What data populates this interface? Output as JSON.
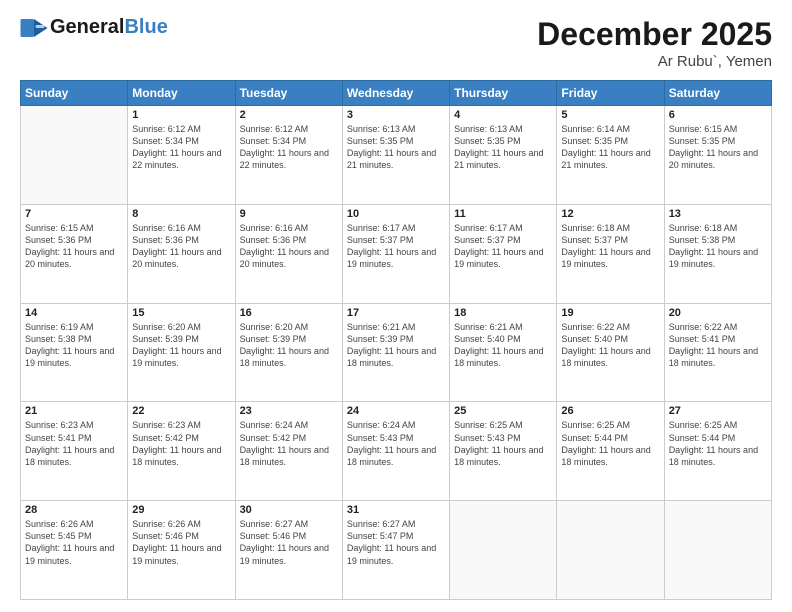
{
  "header": {
    "logo_general": "General",
    "logo_blue": "Blue",
    "month": "December 2025",
    "location": "Ar Rubu`, Yemen"
  },
  "days_of_week": [
    "Sunday",
    "Monday",
    "Tuesday",
    "Wednesday",
    "Thursday",
    "Friday",
    "Saturday"
  ],
  "weeks": [
    [
      {
        "day": "",
        "info": ""
      },
      {
        "day": "1",
        "info": "Sunrise: 6:12 AM\nSunset: 5:34 PM\nDaylight: 11 hours and 22 minutes."
      },
      {
        "day": "2",
        "info": "Sunrise: 6:12 AM\nSunset: 5:34 PM\nDaylight: 11 hours and 22 minutes."
      },
      {
        "day": "3",
        "info": "Sunrise: 6:13 AM\nSunset: 5:35 PM\nDaylight: 11 hours and 21 minutes."
      },
      {
        "day": "4",
        "info": "Sunrise: 6:13 AM\nSunset: 5:35 PM\nDaylight: 11 hours and 21 minutes."
      },
      {
        "day": "5",
        "info": "Sunrise: 6:14 AM\nSunset: 5:35 PM\nDaylight: 11 hours and 21 minutes."
      },
      {
        "day": "6",
        "info": "Sunrise: 6:15 AM\nSunset: 5:35 PM\nDaylight: 11 hours and 20 minutes."
      }
    ],
    [
      {
        "day": "7",
        "info": "Sunrise: 6:15 AM\nSunset: 5:36 PM\nDaylight: 11 hours and 20 minutes."
      },
      {
        "day": "8",
        "info": "Sunrise: 6:16 AM\nSunset: 5:36 PM\nDaylight: 11 hours and 20 minutes."
      },
      {
        "day": "9",
        "info": "Sunrise: 6:16 AM\nSunset: 5:36 PM\nDaylight: 11 hours and 20 minutes."
      },
      {
        "day": "10",
        "info": "Sunrise: 6:17 AM\nSunset: 5:37 PM\nDaylight: 11 hours and 19 minutes."
      },
      {
        "day": "11",
        "info": "Sunrise: 6:17 AM\nSunset: 5:37 PM\nDaylight: 11 hours and 19 minutes."
      },
      {
        "day": "12",
        "info": "Sunrise: 6:18 AM\nSunset: 5:37 PM\nDaylight: 11 hours and 19 minutes."
      },
      {
        "day": "13",
        "info": "Sunrise: 6:18 AM\nSunset: 5:38 PM\nDaylight: 11 hours and 19 minutes."
      }
    ],
    [
      {
        "day": "14",
        "info": "Sunrise: 6:19 AM\nSunset: 5:38 PM\nDaylight: 11 hours and 19 minutes."
      },
      {
        "day": "15",
        "info": "Sunrise: 6:20 AM\nSunset: 5:39 PM\nDaylight: 11 hours and 19 minutes."
      },
      {
        "day": "16",
        "info": "Sunrise: 6:20 AM\nSunset: 5:39 PM\nDaylight: 11 hours and 18 minutes."
      },
      {
        "day": "17",
        "info": "Sunrise: 6:21 AM\nSunset: 5:39 PM\nDaylight: 11 hours and 18 minutes."
      },
      {
        "day": "18",
        "info": "Sunrise: 6:21 AM\nSunset: 5:40 PM\nDaylight: 11 hours and 18 minutes."
      },
      {
        "day": "19",
        "info": "Sunrise: 6:22 AM\nSunset: 5:40 PM\nDaylight: 11 hours and 18 minutes."
      },
      {
        "day": "20",
        "info": "Sunrise: 6:22 AM\nSunset: 5:41 PM\nDaylight: 11 hours and 18 minutes."
      }
    ],
    [
      {
        "day": "21",
        "info": "Sunrise: 6:23 AM\nSunset: 5:41 PM\nDaylight: 11 hours and 18 minutes."
      },
      {
        "day": "22",
        "info": "Sunrise: 6:23 AM\nSunset: 5:42 PM\nDaylight: 11 hours and 18 minutes."
      },
      {
        "day": "23",
        "info": "Sunrise: 6:24 AM\nSunset: 5:42 PM\nDaylight: 11 hours and 18 minutes."
      },
      {
        "day": "24",
        "info": "Sunrise: 6:24 AM\nSunset: 5:43 PM\nDaylight: 11 hours and 18 minutes."
      },
      {
        "day": "25",
        "info": "Sunrise: 6:25 AM\nSunset: 5:43 PM\nDaylight: 11 hours and 18 minutes."
      },
      {
        "day": "26",
        "info": "Sunrise: 6:25 AM\nSunset: 5:44 PM\nDaylight: 11 hours and 18 minutes."
      },
      {
        "day": "27",
        "info": "Sunrise: 6:25 AM\nSunset: 5:44 PM\nDaylight: 11 hours and 18 minutes."
      }
    ],
    [
      {
        "day": "28",
        "info": "Sunrise: 6:26 AM\nSunset: 5:45 PM\nDaylight: 11 hours and 19 minutes."
      },
      {
        "day": "29",
        "info": "Sunrise: 6:26 AM\nSunset: 5:46 PM\nDaylight: 11 hours and 19 minutes."
      },
      {
        "day": "30",
        "info": "Sunrise: 6:27 AM\nSunset: 5:46 PM\nDaylight: 11 hours and 19 minutes."
      },
      {
        "day": "31",
        "info": "Sunrise: 6:27 AM\nSunset: 5:47 PM\nDaylight: 11 hours and 19 minutes."
      },
      {
        "day": "",
        "info": ""
      },
      {
        "day": "",
        "info": ""
      },
      {
        "day": "",
        "info": ""
      }
    ]
  ]
}
